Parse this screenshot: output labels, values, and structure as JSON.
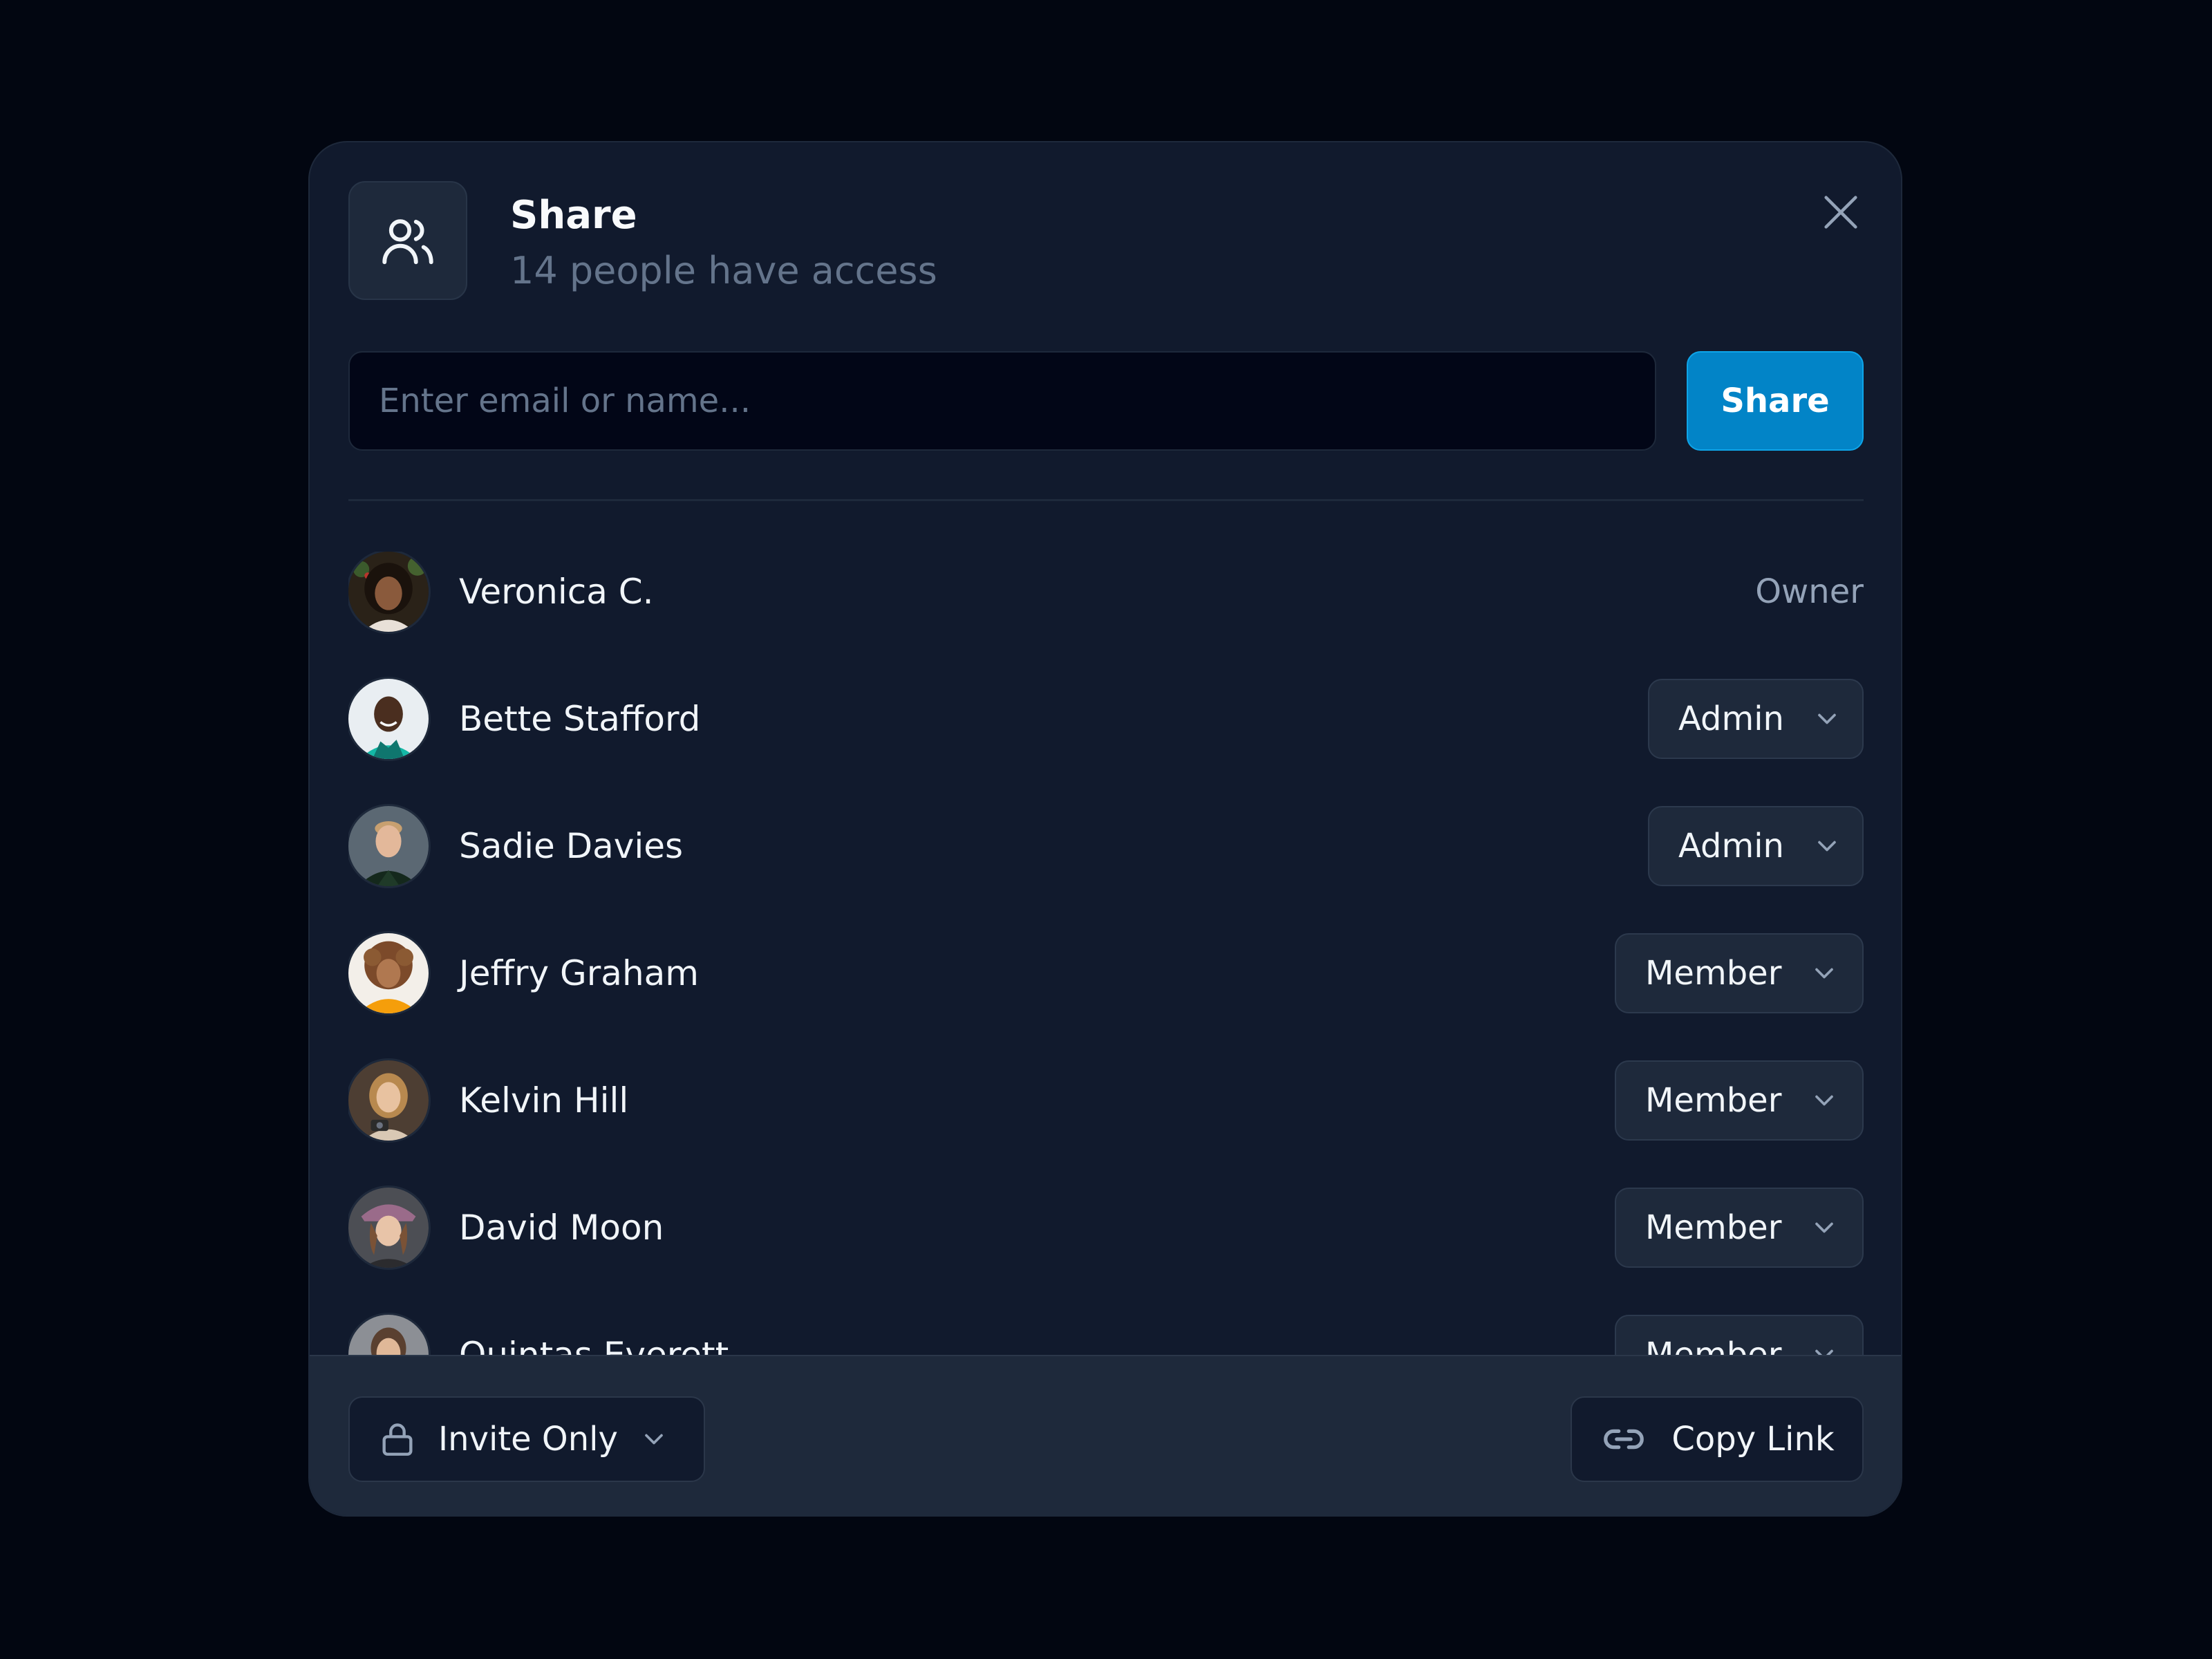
{
  "dialog": {
    "title": "Share",
    "subtitle": "14 people have access",
    "header_icon": "users-icon",
    "close_icon": "close-icon"
  },
  "invite": {
    "placeholder": "Enter email or name...",
    "value": "",
    "share_label": "Share"
  },
  "members": [
    {
      "name": "Veronica C.",
      "role": "Owner",
      "editable": false,
      "avatar_bg": "#2a2218"
    },
    {
      "name": "Bette Stafford",
      "role": "Admin",
      "editable": true,
      "avatar_bg": "#e9eef2"
    },
    {
      "name": "Sadie Davies",
      "role": "Admin",
      "editable": true,
      "avatar_bg": "#5b6873"
    },
    {
      "name": "Jeffry Graham",
      "role": "Member",
      "editable": true,
      "avatar_bg": "#f3efe9"
    },
    {
      "name": "Kelvin Hill",
      "role": "Member",
      "editable": true,
      "avatar_bg": "#4d3e33"
    },
    {
      "name": "David Moon",
      "role": "Member",
      "editable": true,
      "avatar_bg": "#4c4e54"
    },
    {
      "name": "Quintas Everett",
      "role": "Member",
      "editable": true,
      "avatar_bg": "#8c8f95"
    }
  ],
  "footer": {
    "access_label": "Invite Only",
    "access_icon": "lock-icon",
    "copy_label": "Copy Link",
    "copy_icon": "link-icon"
  },
  "colors": {
    "background": "#020611",
    "dialog": "#111a2d",
    "accent": "#0284c7",
    "muted_text": "#64748b"
  }
}
